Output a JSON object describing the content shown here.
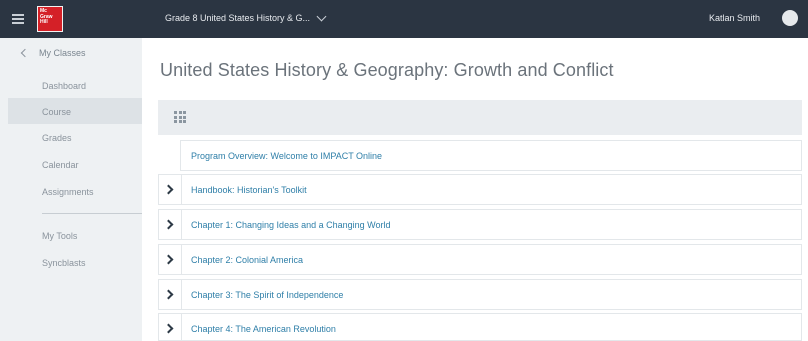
{
  "header": {
    "logo_text": "Mc Graw Hill",
    "course_selector": "Grade 8 United States History & G...",
    "user_name": "Katlan Smith"
  },
  "sidebar": {
    "back_label": "My Classes",
    "items": [
      {
        "label": "Dashboard",
        "active": false
      },
      {
        "label": "Course",
        "active": true
      },
      {
        "label": "Grades",
        "active": false
      },
      {
        "label": "Calendar",
        "active": false
      },
      {
        "label": "Assignments",
        "active": false
      },
      {
        "label": "My Tools",
        "active": false
      },
      {
        "label": "Syncblasts",
        "active": false
      }
    ]
  },
  "main": {
    "title": "United States History & Geography: Growth and Conflict",
    "rows": [
      {
        "label": "Program Overview: Welcome to IMPACT Online",
        "expandable": false
      },
      {
        "label": "Handbook: Historian's Toolkit",
        "expandable": true
      },
      {
        "label": "Chapter 1: Changing Ideas and a Changing World",
        "expandable": true
      },
      {
        "label": "Chapter 2: Colonial America",
        "expandable": true
      },
      {
        "label": "Chapter 3: The Spirit of Independence",
        "expandable": true
      },
      {
        "label": "Chapter 4: The American Revolution",
        "expandable": true
      }
    ]
  },
  "colors": {
    "topbar": "#2b3542",
    "sidebar": "#eef1f3",
    "link": "#2f7fa8",
    "logo_red": "#d42027"
  }
}
